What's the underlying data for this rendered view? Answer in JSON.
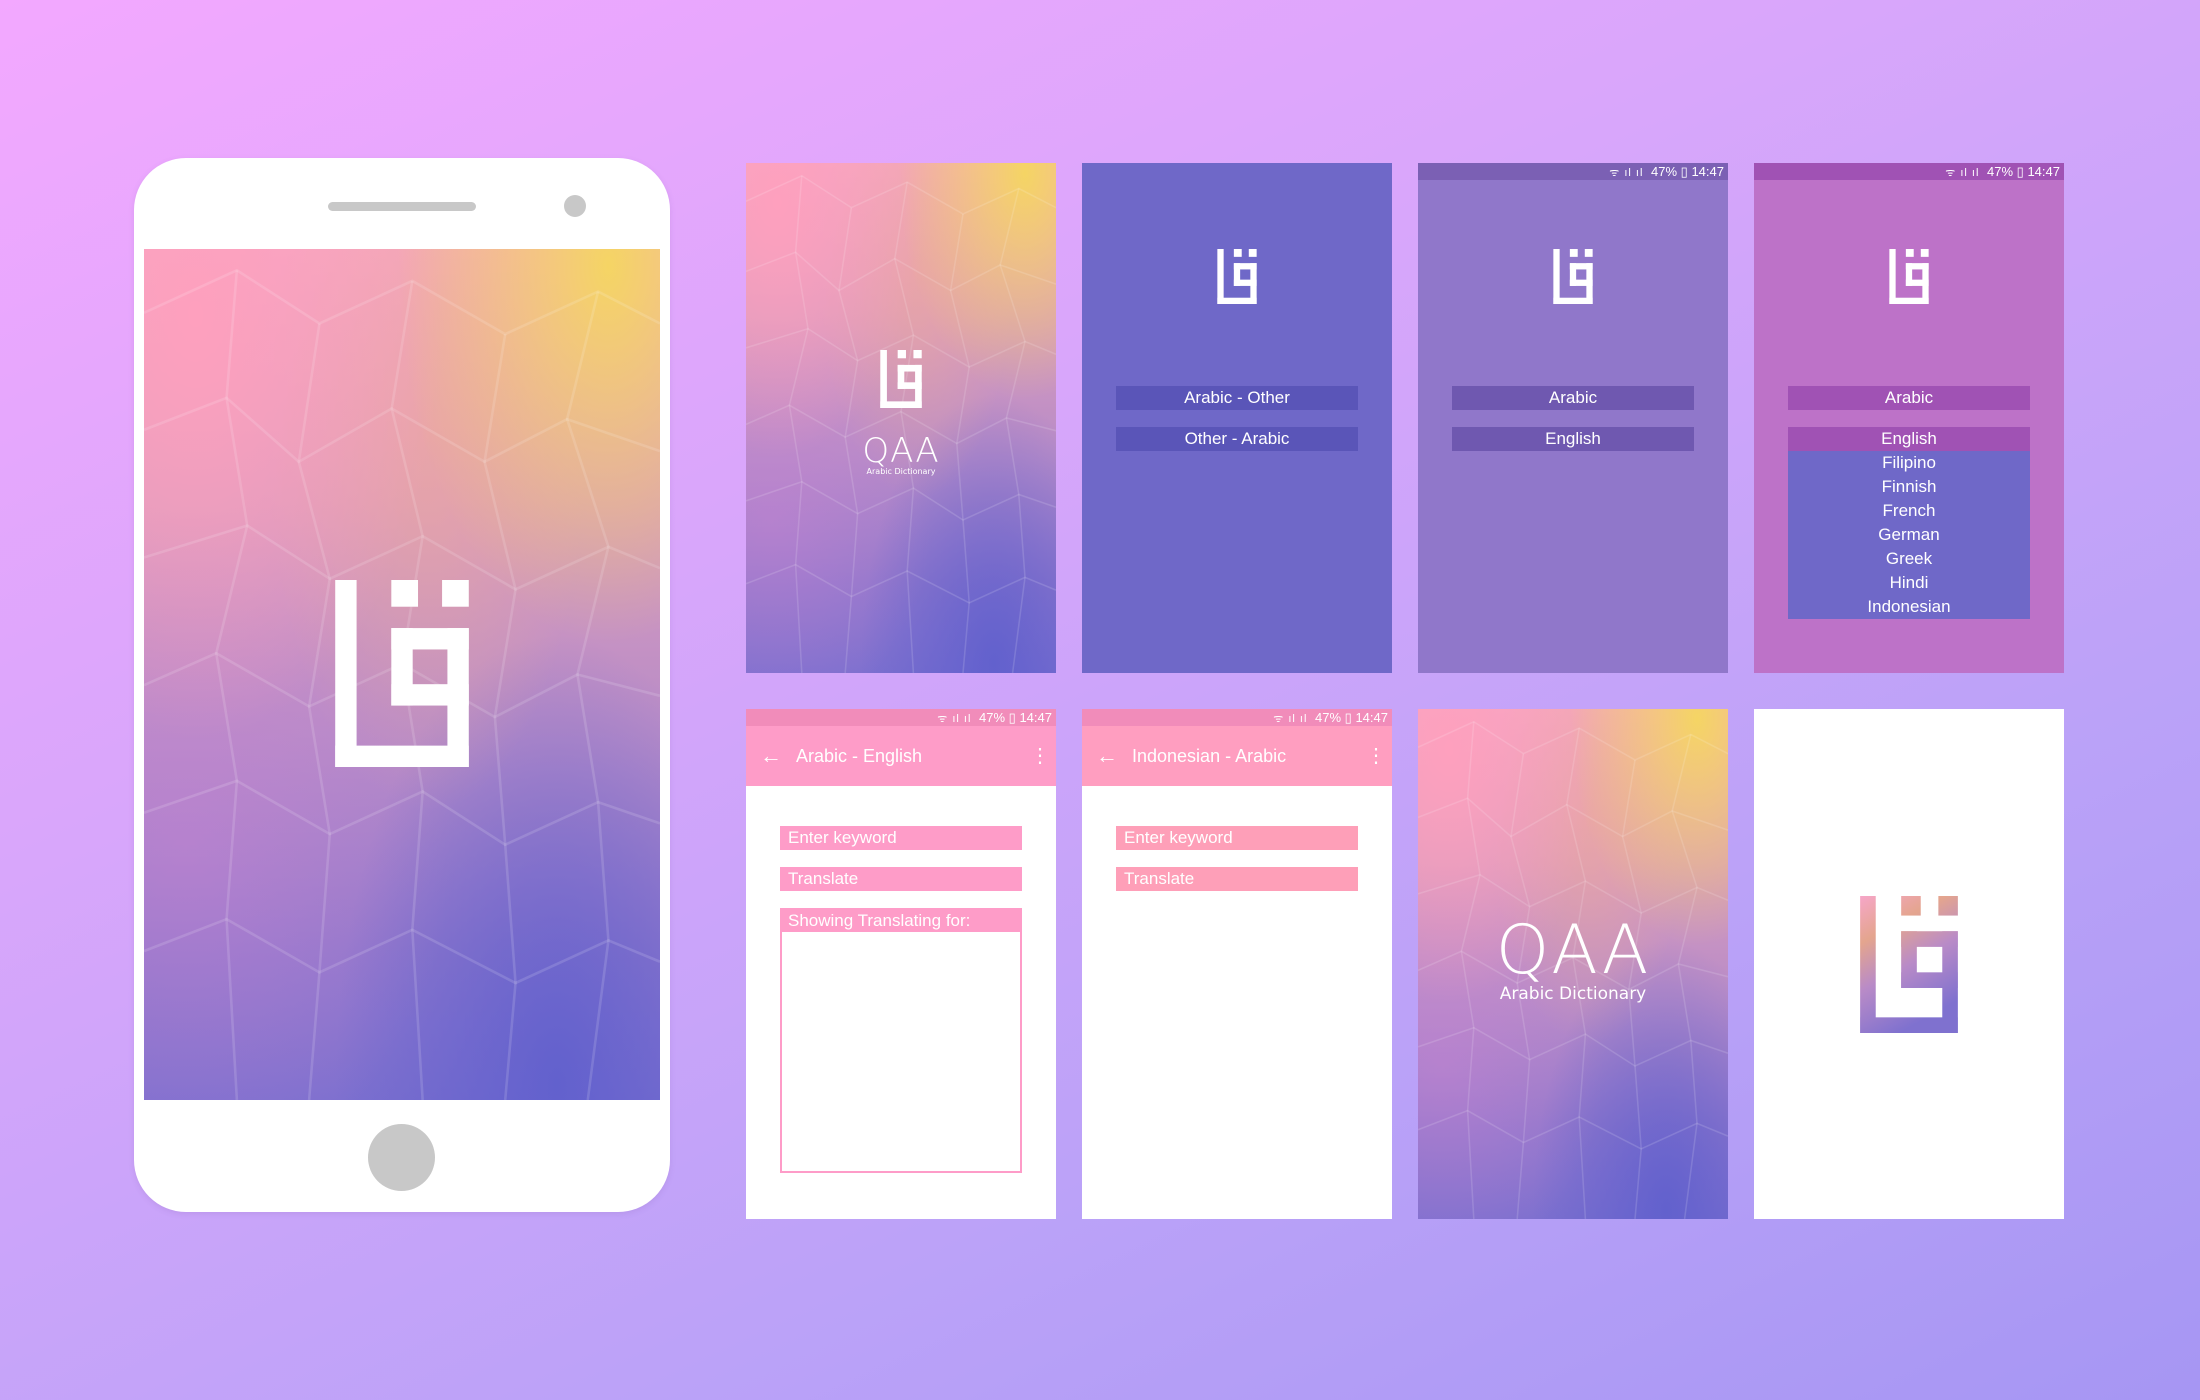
{
  "brand": {
    "logo_name": "QAA",
    "logo_subtitle": "Arabic Dictionary"
  },
  "colors": {
    "screen_blue": "#6f68c8",
    "screen_lilac": "#9077ca",
    "screen_magenta": "#bd72c8",
    "toolbar_pink": "#fe9cc8",
    "field_pink": "#fe9cc8"
  },
  "status_bar": {
    "battery": "47%",
    "time": "14:47"
  },
  "mode_screen": {
    "options": [
      "Arabic - Other",
      "Other - Arabic"
    ]
  },
  "language_screen": {
    "source": "Arabic",
    "target": "English"
  },
  "dropdown_screen": {
    "source": "Arabic",
    "selected": "English",
    "options": [
      "Filipino",
      "Finnish",
      "French",
      "German",
      "Greek",
      "Hindi",
      "Indonesian"
    ]
  },
  "translate_screen_1": {
    "title": "Arabic - English",
    "keyword_placeholder": "Enter keyword",
    "translate_label": "Translate",
    "result_label": "Showing Translating for:"
  },
  "translate_screen_2": {
    "title": "Indonesian - Arabic",
    "keyword_placeholder": "Enter keyword",
    "translate_label": "Translate"
  }
}
